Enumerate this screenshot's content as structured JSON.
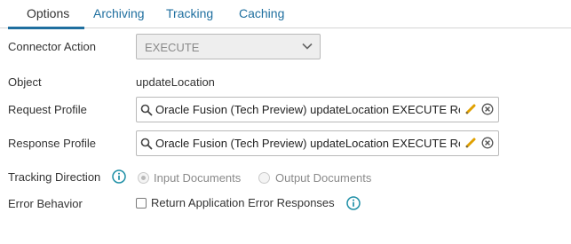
{
  "tabs": [
    {
      "label": "Options",
      "active": true
    },
    {
      "label": "Archiving",
      "active": false
    },
    {
      "label": "Tracking",
      "active": false
    },
    {
      "label": "Caching",
      "active": false
    }
  ],
  "connector_action": {
    "label": "Connector Action",
    "value": "EXECUTE"
  },
  "object": {
    "label": "Object",
    "value": "updateLocation"
  },
  "request_profile": {
    "label": "Request Profile",
    "value": "Oracle Fusion (Tech Preview) updateLocation EXECUTE Request"
  },
  "response_profile": {
    "label": "Response Profile",
    "value": "Oracle Fusion (Tech Preview) updateLocation EXECUTE Response"
  },
  "tracking_direction": {
    "label": "Tracking Direction",
    "options": [
      {
        "label": "Input Documents",
        "selected": true,
        "disabled": true
      },
      {
        "label": "Output Documents",
        "selected": false,
        "disabled": true
      }
    ]
  },
  "error_behavior": {
    "label": "Error Behavior",
    "checkbox_label": "Return Application Error Responses",
    "checked": false
  },
  "colors": {
    "link": "#1f6f9f",
    "info": "#1e8fa6",
    "pencil": "#e0a000"
  }
}
